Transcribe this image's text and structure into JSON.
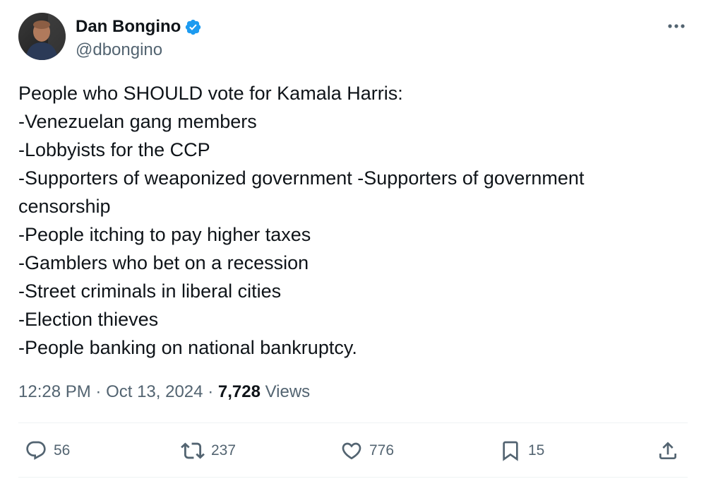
{
  "author": {
    "display_name": "Dan Bongino",
    "handle": "@dbongino"
  },
  "tweet": {
    "lines": [
      "People who SHOULD vote for Kamala Harris:",
      "-Venezuelan gang members",
      "-Lobbyists for the CCP",
      "-Supporters of weaponized government -Supporters of government",
      "censorship",
      "-People itching to pay higher taxes",
      "-Gamblers who bet on a recession",
      "-Street criminals in liberal cities",
      "-Election thieves",
      "-People banking on national bankruptcy."
    ]
  },
  "meta": {
    "time": "12:28 PM",
    "separator": "·",
    "date": "Oct 13, 2024",
    "views_count": "7,728",
    "views_label": "Views"
  },
  "actions": {
    "replies": "56",
    "reposts": "237",
    "likes": "776",
    "bookmarks": "15"
  },
  "colors": {
    "text_primary": "#0f1419",
    "text_secondary": "#536471",
    "verified_blue": "#1d9bf0",
    "divider": "#eff3f4"
  },
  "icons": {
    "verified": "verified-badge-icon",
    "more": "more-dots-icon",
    "reply": "reply-bubble-icon",
    "repost": "repost-arrows-icon",
    "like": "heart-icon",
    "bookmark": "bookmark-icon",
    "share": "share-upload-icon"
  }
}
